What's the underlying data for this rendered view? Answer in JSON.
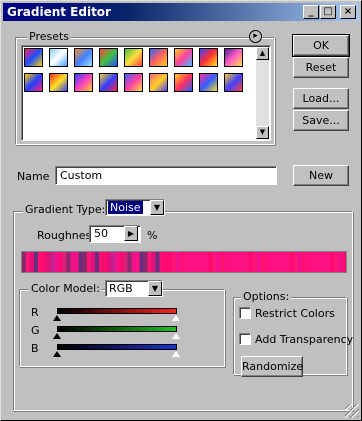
{
  "window": {
    "title": "Gradient Editor",
    "minimize_glyph": "_",
    "maximize_glyph": "□",
    "close_glyph": "×"
  },
  "presets": {
    "label": "Presets",
    "menu_glyph": "▸",
    "swatches": [
      {
        "colors": [
          "#ff2060",
          "#1e50ff",
          "#ffd400"
        ]
      },
      {
        "colors": [
          "#8ad0ff",
          "#ffffff",
          "#40a0ff"
        ]
      },
      {
        "colors": [
          "#ff9020",
          "#4080ff",
          "#a0e0ff"
        ]
      },
      {
        "colors": [
          "#ff4040",
          "#40c040",
          "#2050ff"
        ]
      },
      {
        "colors": [
          "#40c040",
          "#ffe040",
          "#ff4040"
        ]
      },
      {
        "colors": [
          "#3060ff",
          "#ff6060",
          "#ffd020"
        ]
      },
      {
        "colors": [
          "#ffd020",
          "#ff40a0",
          "#40c0ff"
        ]
      },
      {
        "colors": [
          "#4040ff",
          "#ff3030",
          "#ffe020"
        ]
      },
      {
        "colors": [
          "#5020a0",
          "#ff60c0",
          "#ffe040"
        ]
      },
      {
        "colors": [
          "#ffd000",
          "#2040ff",
          "#ff2080"
        ]
      },
      {
        "colors": [
          "#ff3020",
          "#ffe020",
          "#3040ff"
        ]
      },
      {
        "colors": [
          "#3040ff",
          "#ff40c0",
          "#ffd020"
        ]
      },
      {
        "colors": [
          "#ffd020",
          "#3040ff",
          "#ff2040"
        ]
      },
      {
        "colors": [
          "#4060ff",
          "#ff40a0",
          "#ffe040"
        ]
      },
      {
        "colors": [
          "#ff6080",
          "#ffd020",
          "#5040ff"
        ]
      },
      {
        "colors": [
          "#ffd020",
          "#ff3060",
          "#3060ff"
        ]
      },
      {
        "colors": [
          "#ff30a0",
          "#3060ff",
          "#ffe020"
        ]
      },
      {
        "colors": [
          "#ffd020",
          "#4040ff",
          "#ff4040"
        ]
      }
    ]
  },
  "buttons": {
    "ok": "OK",
    "reset": "Reset",
    "load": "Load...",
    "save": "Save...",
    "new": "New",
    "randomize": "Randomize"
  },
  "name": {
    "label": "Name",
    "value": "Custom"
  },
  "gradient": {
    "type_label": "Gradient Type:",
    "type_value": "Noise",
    "roughness_label": "Roughness:",
    "roughness_value": "50",
    "roughness_unit": "%",
    "preview_colors": [
      "#8a2a6a",
      "#c0248c",
      "#6a2e80",
      "#d8207a",
      "#e0107a",
      "#ff1080",
      "#ff0a70",
      "#ff1478",
      "#f01090",
      "#ff0f70"
    ]
  },
  "color_model": {
    "label": "Color Model:",
    "value": "RGB",
    "channels": [
      {
        "label": "R",
        "from": "#000000",
        "to": "#ff2020"
      },
      {
        "label": "G",
        "from": "#000000",
        "to": "#20c020"
      },
      {
        "label": "B",
        "from": "#000000",
        "to": "#2030d0"
      }
    ]
  },
  "options": {
    "label": "Options:",
    "restrict_colors": {
      "label": "Restrict Colors",
      "checked": false
    },
    "add_transparency": {
      "label": "Add Transparency",
      "checked": false
    }
  }
}
